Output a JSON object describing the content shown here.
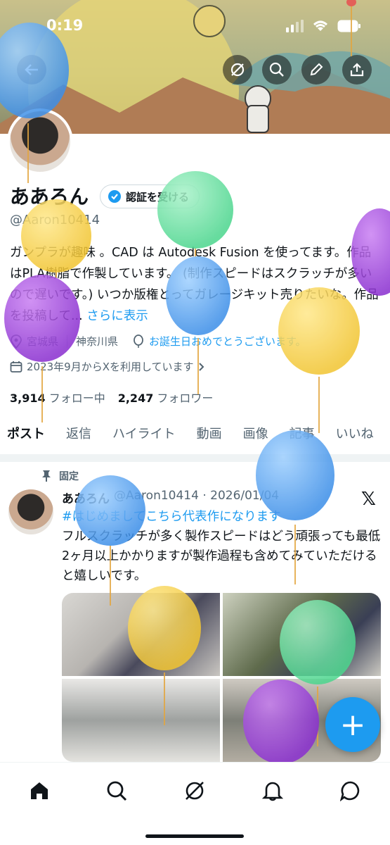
{
  "status_bar": {
    "time": "0:19"
  },
  "colors": {
    "accent": "#1d9bf0",
    "text": "#0f1419",
    "muted": "#536471"
  },
  "header": {
    "buttons": [
      "back-icon",
      "grok-icon",
      "search-icon",
      "edit-icon",
      "share-icon"
    ]
  },
  "profile": {
    "name": "ああろん",
    "verify_label": "認証を受ける",
    "handle": "@Aaron10414",
    "bio": "ガンプラが趣味 。CAD は Autodesk Fusion を使ってます。作品はPLA樹脂で作製しています。 (制作スピードはスクラッチが多いので遅いです。) いつか版権とってガレージキット売りたいな。作品を投稿して...",
    "bio_more": "さらに表示",
    "location1": "宮城県",
    "location2": "神奈川県",
    "birthday_msg": "お誕生日おめでとうございます。",
    "joined": "2023年9月からXを利用しています",
    "following_count": "3,914",
    "following_label": "フォロー中",
    "followers_count": "2,247",
    "followers_label": "フォロワー"
  },
  "tabs": [
    "ポスト",
    "返信",
    "ハイライト",
    "動画",
    "画像",
    "記事",
    "いいね"
  ],
  "post": {
    "pinned_label": "固定",
    "author": "ああろん",
    "handle_date": "@Aaron10414 · 2026/01/04",
    "hashtag": "#はじめましてこちら代表作になります",
    "text": "フルスクラッチが多く製作スピードはどう頑張っても最低2ヶ月以上かかりますが製作過程も含めてみていただけると嬉しいです。"
  },
  "fab_label": "+",
  "bottom_nav": [
    "home-icon",
    "search-icon",
    "grok-icon",
    "notifications-icon",
    "messages-icon"
  ]
}
